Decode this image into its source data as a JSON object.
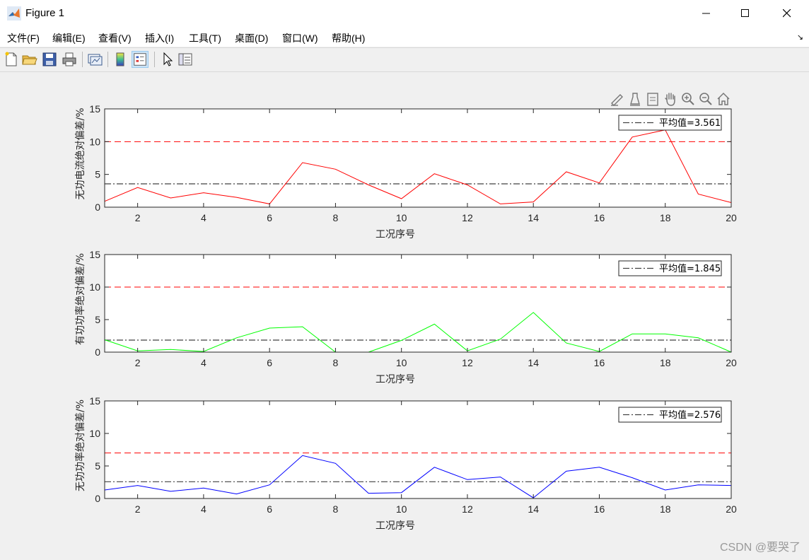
{
  "window": {
    "title": "Figure 1",
    "controls": [
      "minimize",
      "maximize",
      "close"
    ]
  },
  "menu": {
    "items": [
      "文件(F)",
      "编辑(E)",
      "查看(V)",
      "插入(I)",
      "工具(T)",
      "桌面(D)",
      "窗口(W)",
      "帮助(H)"
    ],
    "overflow_arrow": "↘"
  },
  "toolbar": {
    "icons": [
      "new-figure-icon",
      "open-file-icon",
      "save-icon",
      "print-icon",
      "link-plot-icon",
      "colorbar-icon",
      "legend-icon",
      "pointer-icon",
      "property-inspector-icon"
    ]
  },
  "axes_toolbar": {
    "icons": [
      "brush-edit-icon",
      "data-tips-icon",
      "brush-icon",
      "pan-hand-icon",
      "zoom-in-icon",
      "zoom-out-icon",
      "home-restore-icon"
    ]
  },
  "colors": {
    "series1": "#ff0000",
    "series2": "#00ff00",
    "series3": "#0000ff",
    "threshold": "#ff0000",
    "mean": "#404040"
  },
  "chart_data": [
    {
      "type": "line",
      "xlabel": "工况序号",
      "ylabel": "无功电流绝对偏差/%",
      "xlim": [
        1,
        20
      ],
      "ylim": [
        0,
        15
      ],
      "xticks": [
        2,
        4,
        6,
        8,
        10,
        12,
        14,
        16,
        18,
        20
      ],
      "yticks": [
        0,
        5,
        10,
        15
      ],
      "grid": false,
      "legend_position": "top-right",
      "x": [
        1,
        2,
        3,
        4,
        5,
        6,
        7,
        8,
        9,
        10,
        11,
        12,
        13,
        14,
        15,
        16,
        17,
        18,
        19,
        20
      ],
      "series": [
        {
          "values": [
            0.9,
            3.0,
            1.4,
            2.2,
            1.5,
            0.5,
            6.8,
            5.8,
            3.4,
            1.3,
            5.1,
            3.4,
            0.5,
            0.8,
            5.4,
            3.7,
            10.7,
            11.8,
            2.0,
            0.7
          ],
          "color": "#ff0000"
        }
      ],
      "threshold": 10,
      "mean": 3.561,
      "legend_label": "平均值=3.561"
    },
    {
      "type": "line",
      "xlabel": "工况序号",
      "ylabel": "有功功率绝对偏差/%",
      "xlim": [
        1,
        20
      ],
      "ylim": [
        0,
        15
      ],
      "xticks": [
        2,
        4,
        6,
        8,
        10,
        12,
        14,
        16,
        18,
        20
      ],
      "yticks": [
        0,
        5,
        10,
        15
      ],
      "grid": false,
      "legend_position": "top-right",
      "x": [
        1,
        2,
        3,
        4,
        5,
        6,
        7,
        8,
        9,
        10,
        11,
        12,
        13,
        14,
        15,
        16,
        17,
        18,
        19,
        20
      ],
      "series": [
        {
          "values": [
            1.9,
            0.2,
            0.4,
            0.1,
            2.2,
            3.7,
            3.9,
            0.0,
            0.0,
            1.8,
            4.3,
            0.2,
            2.0,
            6.1,
            1.4,
            0.1,
            2.8,
            2.8,
            2.2,
            0.0
          ],
          "color": "#00ff00"
        }
      ],
      "threshold": 10,
      "mean": 1.845,
      "legend_label": "平均值=1.845"
    },
    {
      "type": "line",
      "xlabel": "工况序号",
      "ylabel": "无功功率绝对偏差/%",
      "xlim": [
        1,
        20
      ],
      "ylim": [
        0,
        15
      ],
      "xticks": [
        2,
        4,
        6,
        8,
        10,
        12,
        14,
        16,
        18,
        20
      ],
      "yticks": [
        0,
        5,
        10,
        15
      ],
      "grid": false,
      "legend_position": "top-right",
      "x": [
        1,
        2,
        3,
        4,
        5,
        6,
        7,
        8,
        9,
        10,
        11,
        12,
        13,
        14,
        15,
        16,
        17,
        18,
        19,
        20
      ],
      "series": [
        {
          "values": [
            1.3,
            2.0,
            1.1,
            1.6,
            0.7,
            2.1,
            6.6,
            5.4,
            0.8,
            0.9,
            4.8,
            2.9,
            3.3,
            0.1,
            4.2,
            4.8,
            3.2,
            1.3,
            2.1,
            2.0
          ],
          "color": "#0000ff"
        }
      ],
      "threshold": 7,
      "mean": 2.576,
      "legend_label": "平均值=2.576"
    }
  ],
  "watermark": "CSDN @要哭了"
}
